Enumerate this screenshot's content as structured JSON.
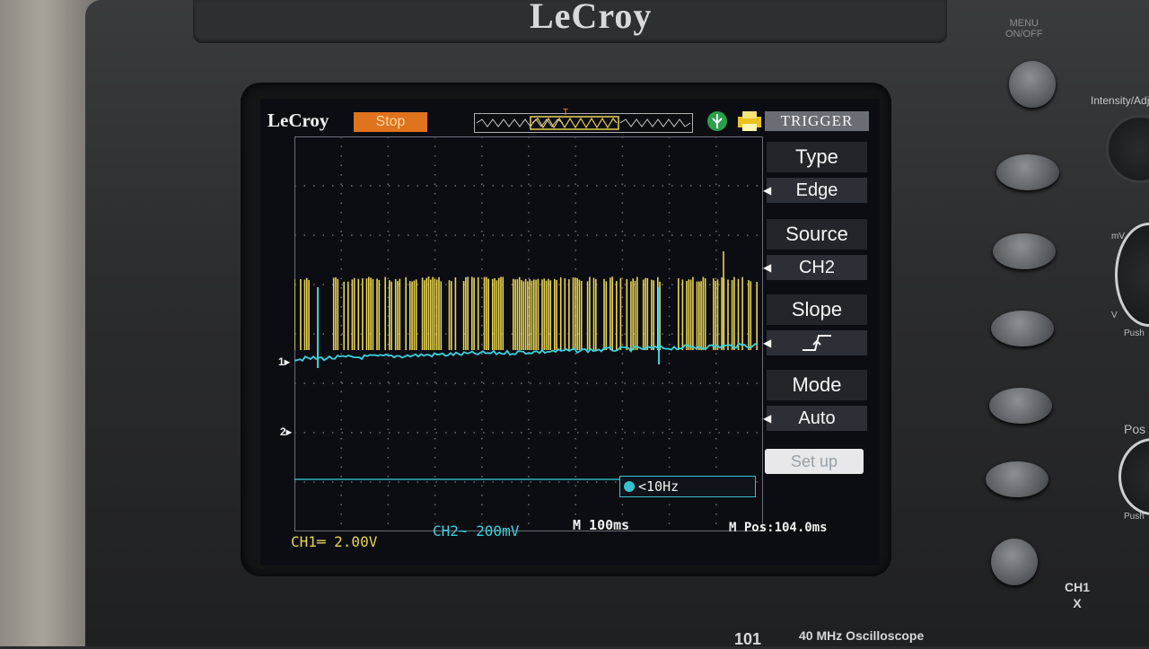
{
  "device": {
    "brand": "LeCroy",
    "model_number": "101",
    "model_description": "40 MHz Oscilloscope",
    "menu_label": "MENU\nON/OFF",
    "intensity_label": "Intensity/Adj",
    "mv_label": "mV",
    "v_label": "V",
    "push_label": "Push",
    "pos_label": "Pos",
    "ch1x_label": "CH1\nX"
  },
  "screen": {
    "brand": "LeCroy",
    "run_state": "Stop",
    "trigger_marker": "T",
    "ch1_marker": "1",
    "ch2_marker": "2",
    "frequency": "<10Hz",
    "status": {
      "ch1": "CH1═ 2.00V",
      "ch2": "CH2∼ 200mV",
      "timebase": "M 100ms",
      "position": "M Pos:104.0ms"
    }
  },
  "menu": {
    "title": "TRIGGER",
    "items": [
      {
        "label": "Type",
        "value": "Edge"
      },
      {
        "label": "Source",
        "value": "CH2"
      },
      {
        "label": "Slope",
        "value": "rising-edge-icon"
      },
      {
        "label": "Mode",
        "value": "Auto"
      }
    ],
    "setup": "Set up"
  },
  "colors": {
    "ch1": "#e8d450",
    "ch2": "#38d2e0",
    "stop": "#e0731d",
    "grid": "#6a6f78"
  }
}
